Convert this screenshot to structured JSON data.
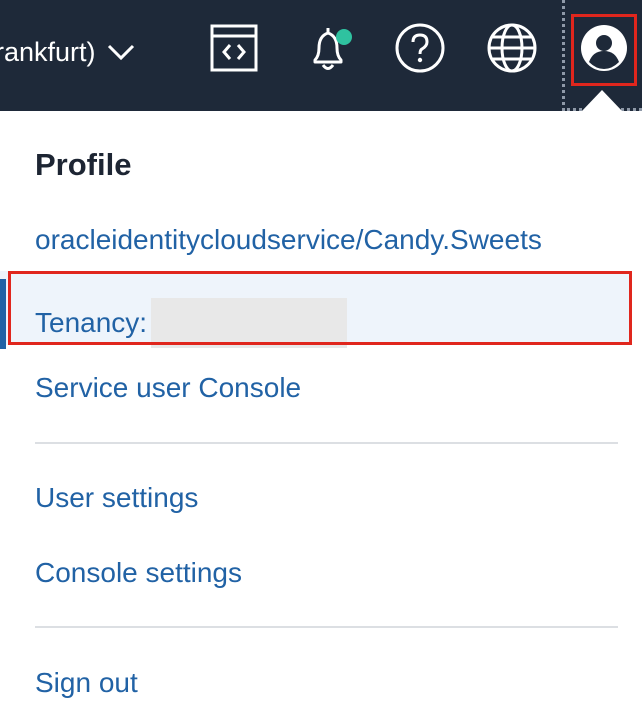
{
  "topbar": {
    "region_label": "rankfurt)",
    "icons": {
      "code": "code-editor-icon",
      "bell": "bell-icon",
      "help": "help-icon",
      "globe": "globe-icon",
      "avatar": "user-avatar-icon"
    },
    "notification_dot_color": "#2fc2a0",
    "bar_color": "#1e2939",
    "highlight_color": "#e0261d"
  },
  "menu": {
    "title": "Profile",
    "user": "oracleidentitycloudservice/Candy.Sweets",
    "tenancy_label": "Tenancy:",
    "service_console": "Service user Console",
    "user_settings": "User settings",
    "console_settings": "Console settings",
    "sign_out": "Sign out",
    "link_color": "#2162a5"
  }
}
